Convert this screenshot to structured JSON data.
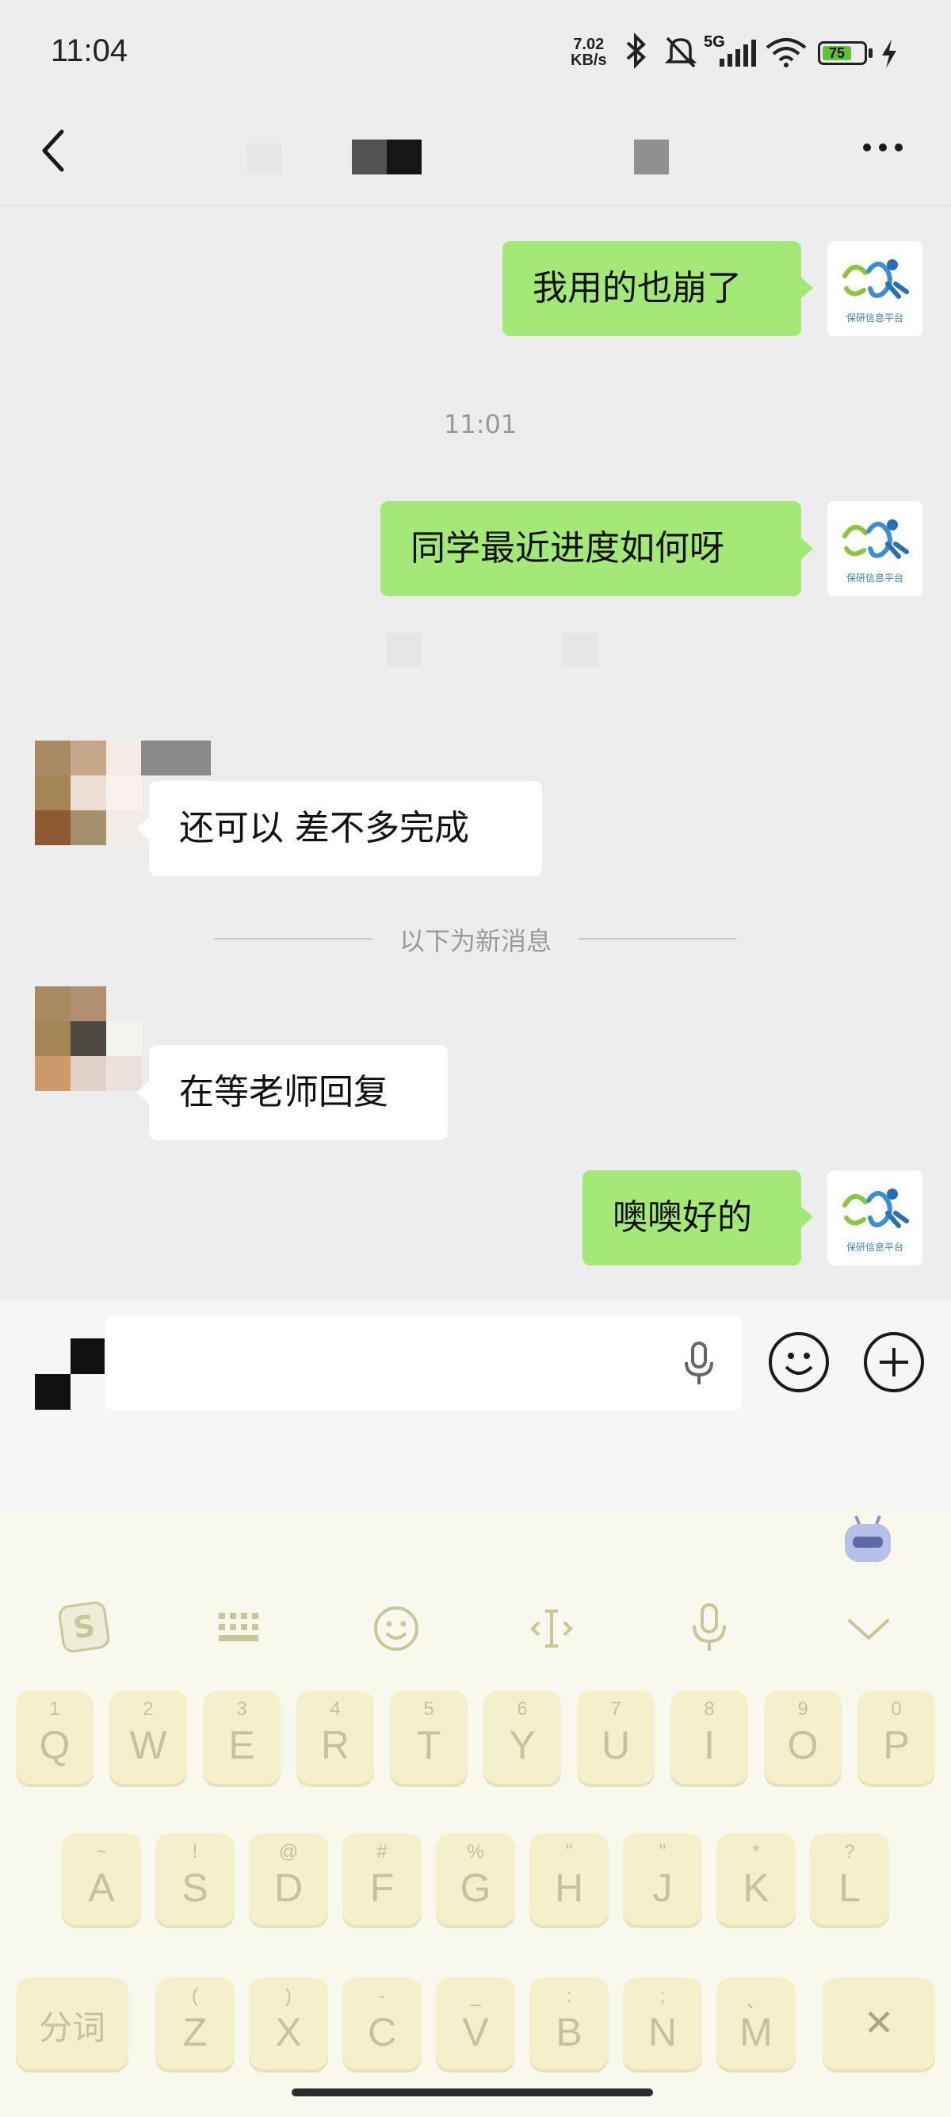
{
  "status_bar": {
    "time": "11:04",
    "net_speed_value": "7.02",
    "net_speed_unit": "KB/s",
    "signal_label": "5G",
    "battery_level": "75",
    "icons": [
      "bluetooth-icon",
      "mute-bell-icon",
      "cell-signal-icon",
      "wifi-icon",
      "battery-icon",
      "charging-icon"
    ]
  },
  "header": {
    "back_icon": "chevron-left-icon",
    "more_icon": "more-dots-icon"
  },
  "messages": [
    {
      "side": "me",
      "text": "我用的也崩了"
    },
    {
      "type": "time",
      "text": "11:01"
    },
    {
      "side": "me",
      "text": "同学最近进度如何呀"
    },
    {
      "side": "them",
      "text": "还可以 差不多完成"
    },
    {
      "type": "divider",
      "text": "以下为新消息"
    },
    {
      "side": "them",
      "text": "在等老师回复"
    },
    {
      "side": "me",
      "text": "噢噢好的"
    }
  ],
  "my_avatar_caption": "保研信息平台",
  "input_bar": {
    "voice_icon": "microphone-icon",
    "emoji_icon": "emoji-smile-icon",
    "plus_icon": "plus-circle-icon"
  },
  "keyboard": {
    "toolbar": [
      "sogou-logo-icon",
      "keyboard-grid-icon",
      "emoji-icon",
      "text-cursor-icon",
      "microphone-icon",
      "chevron-down-icon"
    ],
    "row1": [
      {
        "main": "Q",
        "sub": "1"
      },
      {
        "main": "W",
        "sub": "2"
      },
      {
        "main": "E",
        "sub": "3"
      },
      {
        "main": "R",
        "sub": "4"
      },
      {
        "main": "T",
        "sub": "5"
      },
      {
        "main": "Y",
        "sub": "6"
      },
      {
        "main": "U",
        "sub": "7"
      },
      {
        "main": "I",
        "sub": "8"
      },
      {
        "main": "O",
        "sub": "9"
      },
      {
        "main": "P",
        "sub": "0"
      }
    ],
    "row2": [
      {
        "main": "A",
        "sub": "~"
      },
      {
        "main": "S",
        "sub": "!"
      },
      {
        "main": "D",
        "sub": "@"
      },
      {
        "main": "F",
        "sub": "#"
      },
      {
        "main": "G",
        "sub": "%"
      },
      {
        "main": "H",
        "sub": "\""
      },
      {
        "main": "J",
        "sub": "\""
      },
      {
        "main": "K",
        "sub": "*"
      },
      {
        "main": "L",
        "sub": "?"
      }
    ],
    "row3_left": "分词",
    "row3": [
      {
        "main": "Z",
        "sub": "("
      },
      {
        "main": "X",
        "sub": ")"
      },
      {
        "main": "C",
        "sub": "-"
      },
      {
        "main": "V",
        "sub": "_"
      },
      {
        "main": "B",
        "sub": ":"
      },
      {
        "main": "N",
        "sub": ";"
      },
      {
        "main": "M",
        "sub": "、"
      }
    ],
    "delete_label": "✕"
  }
}
